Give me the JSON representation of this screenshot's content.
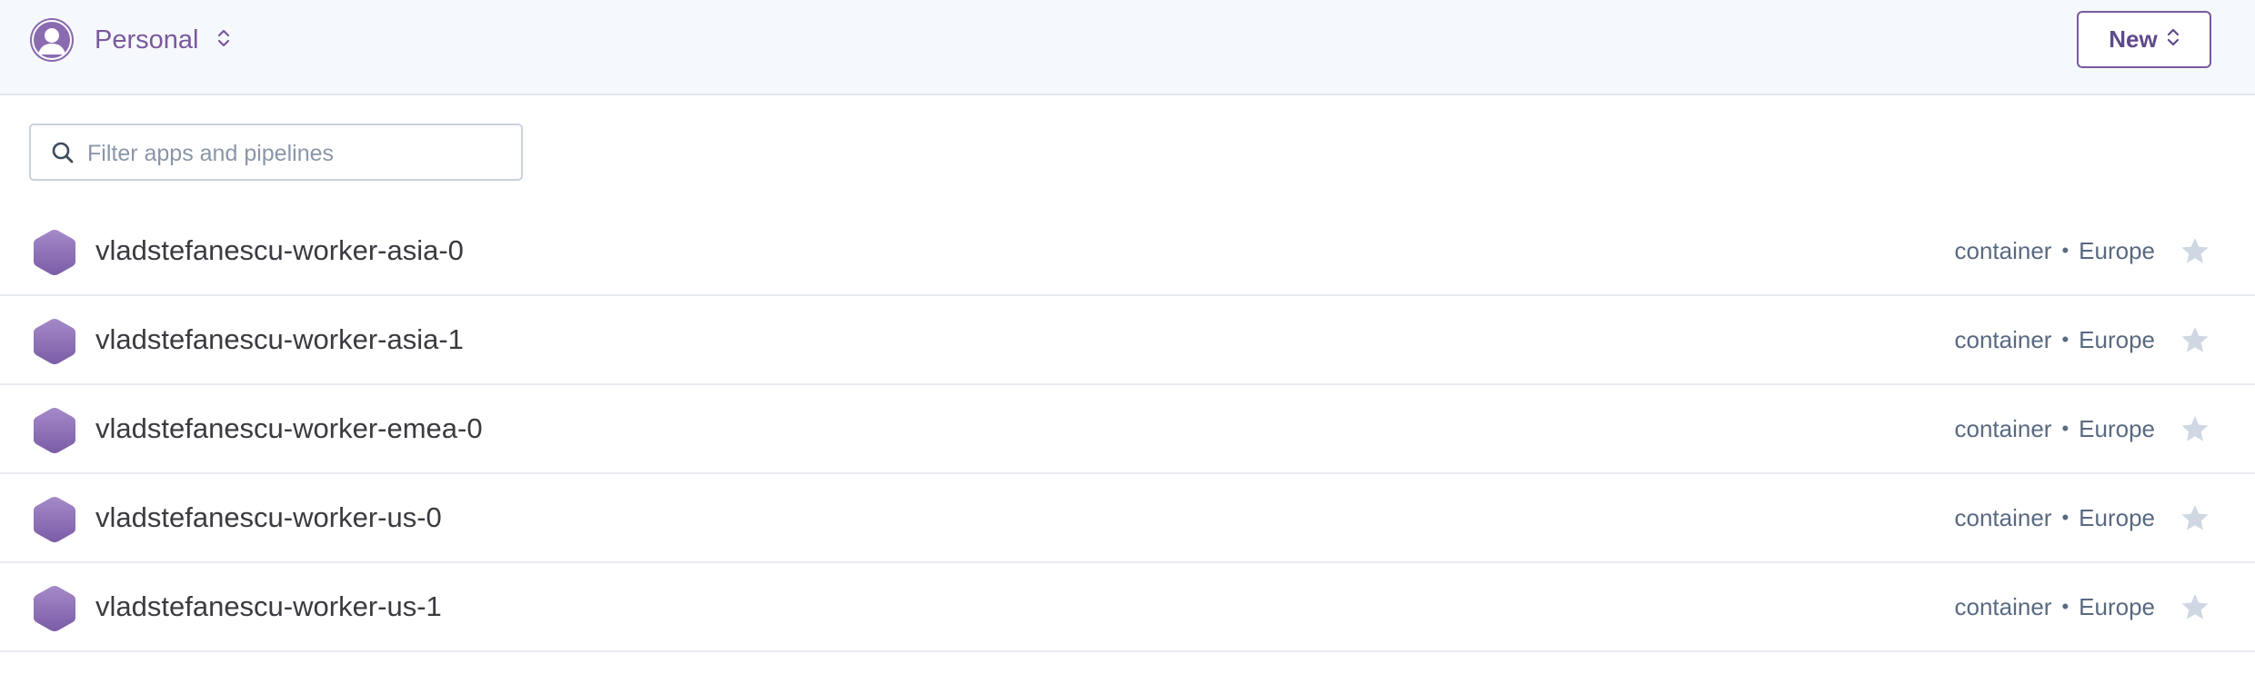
{
  "header": {
    "account_name": "Personal",
    "new_button_label": "New"
  },
  "filter": {
    "placeholder": "Filter apps and pipelines",
    "value": ""
  },
  "apps": [
    {
      "name": "vladstefanescu-worker-asia-0",
      "stack": "container",
      "region": "Europe"
    },
    {
      "name": "vladstefanescu-worker-asia-1",
      "stack": "container",
      "region": "Europe"
    },
    {
      "name": "vladstefanescu-worker-emea-0",
      "stack": "container",
      "region": "Europe"
    },
    {
      "name": "vladstefanescu-worker-us-0",
      "stack": "container",
      "region": "Europe"
    },
    {
      "name": "vladstefanescu-worker-us-1",
      "stack": "container",
      "region": "Europe"
    }
  ],
  "separator": "•",
  "colors": {
    "brand_purple": "#79589f",
    "header_bg": "#f6f9fc",
    "star_inactive": "#cfd7e3"
  },
  "icons": {
    "account": "user-avatar-icon",
    "switcher": "chevron-up-down-icon",
    "search": "search-icon",
    "app": "hexagon-app-icon",
    "favorite": "star-icon"
  }
}
